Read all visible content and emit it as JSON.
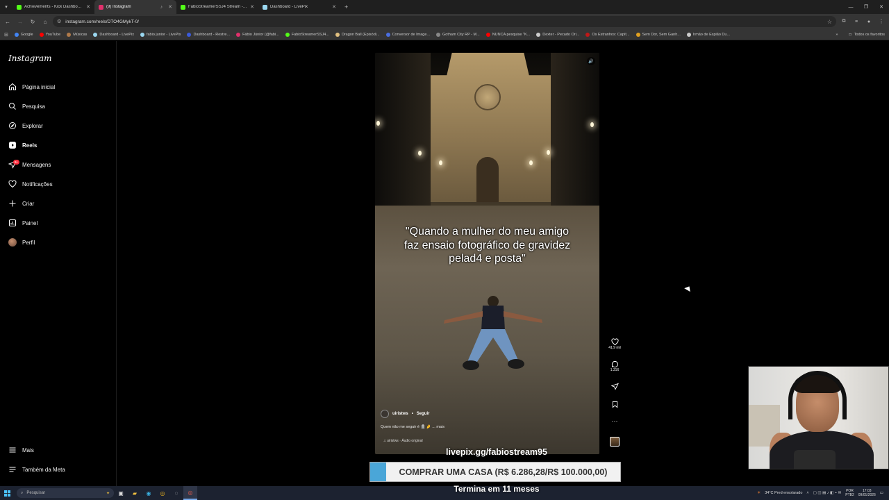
{
  "browser": {
    "tabs": [
      {
        "title": "Achievements - Kick Dashboard",
        "color": "#53fc18",
        "active": false
      },
      {
        "title": "(9) Instagram",
        "color": "#e1306c",
        "active": true
      },
      {
        "title": "FabioStreamerSSJ4 Stream - Ki",
        "color": "#53fc18",
        "active": false
      },
      {
        "title": "Dashboard - LivePix",
        "color": "#9ad7f0",
        "active": false
      }
    ],
    "url": "instagram.com/reels/DTO4GMykT-0/",
    "bookmarks": [
      {
        "label": "Google",
        "color": "#4285f4"
      },
      {
        "label": "YouTube",
        "color": "#ff0000"
      },
      {
        "label": "Músicas",
        "color": "#b07a4a"
      },
      {
        "label": "Dashboard - LivePix",
        "color": "#9ad7f0"
      },
      {
        "label": "fabio junior - LivePix",
        "color": "#9ad7f0"
      },
      {
        "label": "Dashboard - Restre...",
        "color": "#3b5bdb"
      },
      {
        "label": "Fábio Júnior (@fabi...",
        "color": "#e1306c"
      },
      {
        "label": "FabioStreamerSSJ4...",
        "color": "#53fc18"
      },
      {
        "label": "Dragon Ball (Episódi...",
        "color": "#e0c080"
      },
      {
        "label": "Conversor de Image...",
        "color": "#4a6ee0"
      },
      {
        "label": "Gotham City RP - M...",
        "color": "#888888"
      },
      {
        "label": "NUNCA pesquise \"K...",
        "color": "#ff0000"
      },
      {
        "label": "Dexter - Pecado Ori...",
        "color": "#cccccc"
      },
      {
        "label": "Os Estranhos: Capít...",
        "color": "#c01818"
      },
      {
        "label": "Sem Dor, Sem Ganh...",
        "color": "#e0a020"
      },
      {
        "label": "Irmão de Espião Du...",
        "color": "#cccccc"
      }
    ],
    "bookmarks_all": "Todos os favoritos"
  },
  "instagram": {
    "logo": "Instagram",
    "nav": [
      {
        "label": "Página inicial",
        "icon": "home"
      },
      {
        "label": "Pesquisa",
        "icon": "search"
      },
      {
        "label": "Explorar",
        "icon": "compass"
      },
      {
        "label": "Reels",
        "icon": "reels"
      },
      {
        "label": "Mensagens",
        "icon": "send",
        "badge": "9+"
      },
      {
        "label": "Notificações",
        "icon": "heart"
      },
      {
        "label": "Criar",
        "icon": "plus"
      },
      {
        "label": "Painel",
        "icon": "dashboard"
      },
      {
        "label": "Perfil",
        "icon": "avatar"
      }
    ],
    "bottom_nav": [
      {
        "label": "Mais",
        "icon": "menu"
      },
      {
        "label": "Também da Meta",
        "icon": "meta"
      }
    ],
    "reel": {
      "caption_overlay": "\"Quando a mulher do meu amigo faz ensaio fotográfico de gravidez pelad4 e posta\"",
      "author": "uiristws",
      "follow": "Seguir",
      "description": "Quem não me seguir é 🪦 🤌 ... mais",
      "audio": "uiristws · Áudio original",
      "likes": "41,9 mil",
      "comments": "1.316"
    }
  },
  "stream": {
    "livepix": "livepix.gg/fabiostream95",
    "goal": "COMPRAR UMA CASA (R$ 6.286,28/R$ 100.000,00)",
    "goal_progress": 0.063,
    "goal_end": "Termina em 11 meses"
  },
  "taskbar": {
    "search_placeholder": "Pesquisar",
    "weather": "34°C  Pred ensolarado",
    "lang": "POR",
    "lang2": "PTB2",
    "time": "17:03",
    "date": "09/01/2026"
  }
}
